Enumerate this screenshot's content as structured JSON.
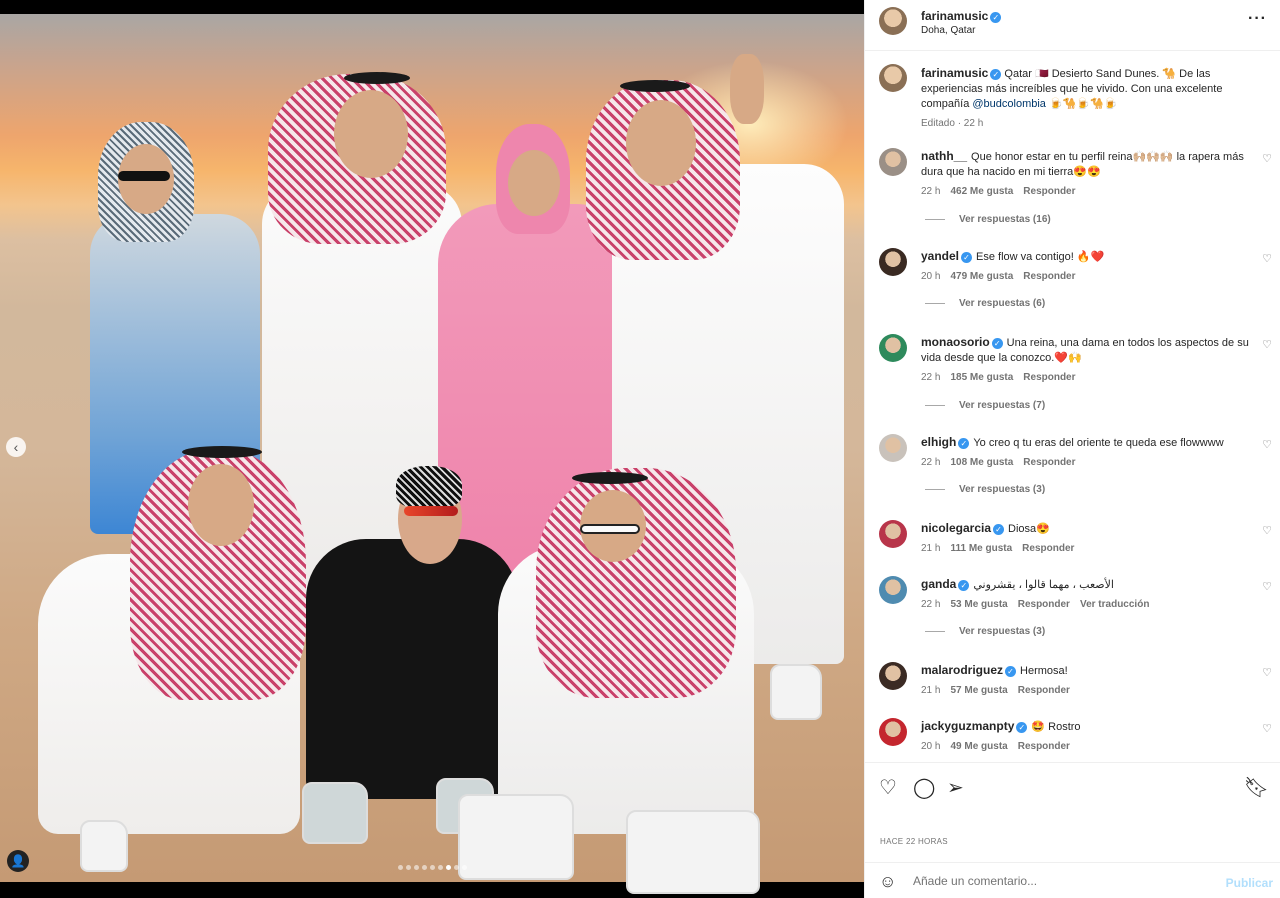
{
  "post": {
    "username": "farinamusic",
    "location": "Doha, Qatar",
    "more_icon": "more-icon"
  },
  "media": {
    "carousel": {
      "total": 9,
      "active": 7
    }
  },
  "caption": {
    "username": "farinamusic",
    "text_before": "Qatar 🇶🇦 Desierto Sand Dunes. 🐪 De las experiencias más increíbles que he vivido. Con una excelente compañía ",
    "mention": "@budcolombia",
    "text_after": " 🍺🐪🍺🐪🍺",
    "meta": "Editado · 22 h"
  },
  "comments": [
    {
      "username": "nathh__",
      "verified": false,
      "text": "Que honor estar en tu perfil reina🙌🏼🙌🏼🙌🏼 la rapera más dura que ha nacido en mi tierra😍😍",
      "time": "22 h",
      "likes": "462 Me gusta",
      "reply": "Responder",
      "replies": "Ver respuestas (16)",
      "avatar_color": "#9a8f86"
    },
    {
      "username": "yandel",
      "verified": true,
      "text": "Ese flow va contigo! 🔥❤️",
      "time": "20 h",
      "likes": "479 Me gusta",
      "reply": "Responder",
      "replies": "Ver respuestas (6)",
      "avatar_color": "#3a2a22"
    },
    {
      "username": "monaosorio",
      "verified": true,
      "text": "Una reina, una dama en todos los aspectos de su vida desde que la conozco.❤️🙌",
      "time": "22 h",
      "likes": "185 Me gusta",
      "reply": "Responder",
      "replies": "Ver respuestas (7)",
      "avatar_color": "#2e8a5c"
    },
    {
      "username": "elhigh",
      "verified": true,
      "text": "Yo creo q tu eras del oriente te queda ese flowwww",
      "time": "22 h",
      "likes": "108 Me gusta",
      "reply": "Responder",
      "replies": "Ver respuestas (3)",
      "avatar_color": "#c9c2bb"
    },
    {
      "username": "nicolegarcia",
      "verified": true,
      "text": "Diosa😍",
      "time": "21 h",
      "likes": "111 Me gusta",
      "reply": "Responder",
      "replies": "",
      "avatar_color": "#b8354a"
    },
    {
      "username": "ganda",
      "verified": true,
      "text": "الأصعب ، مهما قالوا ، يقشروني",
      "time": "22 h",
      "likes": "53 Me gusta",
      "reply": "Responder",
      "translate": "Ver traducción",
      "replies": "Ver respuestas (3)",
      "avatar_color": "#4f8bb0"
    },
    {
      "username": "malarodriguez",
      "verified": true,
      "text": "Hermosa!",
      "time": "21 h",
      "likes": "57 Me gusta",
      "reply": "Responder",
      "replies": "",
      "avatar_color": "#3b2b24"
    },
    {
      "username": "jackyguzmanpty",
      "verified": true,
      "text": "🤩 Rostro",
      "time": "20 h",
      "likes": "49 Me gusta",
      "reply": "Responder",
      "replies": "",
      "avatar_color": "#c4262e"
    }
  ],
  "actions": {
    "time_ago": "HACE 22 HORAS"
  },
  "composer": {
    "placeholder": "Añade un comentario...",
    "publish_label": "Publicar"
  }
}
